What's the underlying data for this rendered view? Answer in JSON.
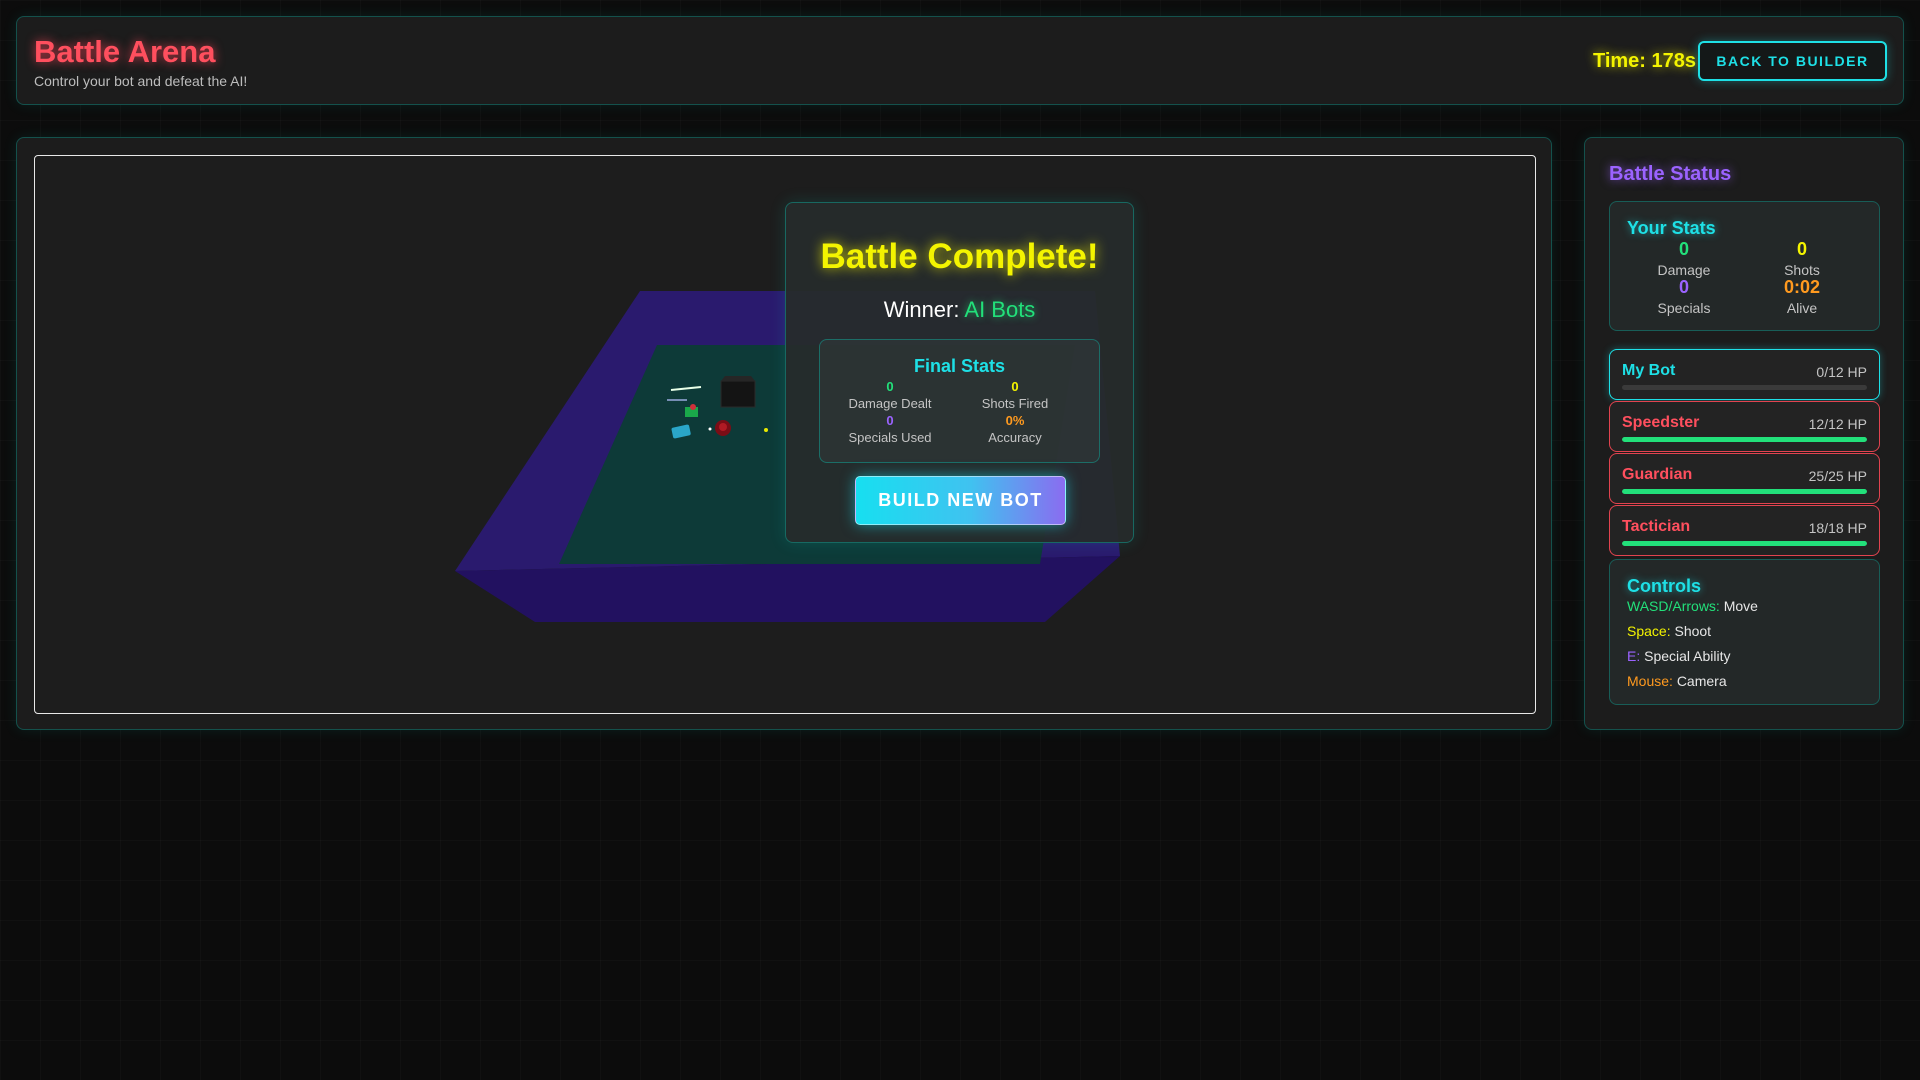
{
  "header": {
    "title": "Battle Arena",
    "subtitle": "Control your bot and defeat the AI!",
    "timer": "Time: 178s",
    "back_button": "BACK TO BUILDER"
  },
  "modal": {
    "title": "Battle Complete!",
    "winner_label": "Winner: ",
    "winner_name": "AI Bots",
    "final_stats": {
      "title": "Final Stats",
      "damage_dealt": {
        "value": "0",
        "label": "Damage Dealt"
      },
      "shots_fired": {
        "value": "0",
        "label": "Shots Fired"
      },
      "specials_used": {
        "value": "0",
        "label": "Specials Used"
      },
      "accuracy": {
        "value": "0%",
        "label": "Accuracy"
      }
    },
    "build_button": "BUILD NEW BOT"
  },
  "status": {
    "title": "Battle Status",
    "your_stats": {
      "title": "Your Stats",
      "damage": {
        "value": "0",
        "label": "Damage"
      },
      "shots": {
        "value": "0",
        "label": "Shots"
      },
      "specials": {
        "value": "0",
        "label": "Specials"
      },
      "alive": {
        "value": "0:02",
        "label": "Alive"
      }
    },
    "bots": [
      {
        "name": "My Bot",
        "hp": "0/12 HP",
        "hp_fraction": 0.0
      },
      {
        "name": "Speedster",
        "hp": "12/12 HP",
        "hp_fraction": 1.0
      },
      {
        "name": "Guardian",
        "hp": "25/25 HP",
        "hp_fraction": 1.0
      },
      {
        "name": "Tactician",
        "hp": "18/18 HP",
        "hp_fraction": 1.0
      }
    ],
    "controls": {
      "title": "Controls",
      "items": [
        {
          "key": "WASD/Arrows:",
          "action": "Move"
        },
        {
          "key": "Space:",
          "action": "Shoot"
        },
        {
          "key": "E:",
          "action": "Special Ability"
        },
        {
          "key": "Mouse:",
          "action": "Camera"
        }
      ]
    }
  },
  "colors": {
    "accent_cyan": "#1ee0e6",
    "accent_red": "#ff4f5e",
    "accent_yellow": "#f4f400",
    "accent_green": "#22e07a",
    "accent_purple": "#9b63ff",
    "accent_orange": "#ff9a1f",
    "arena_wall": "#2a1a6e",
    "arena_floor": "#0d3a38"
  }
}
